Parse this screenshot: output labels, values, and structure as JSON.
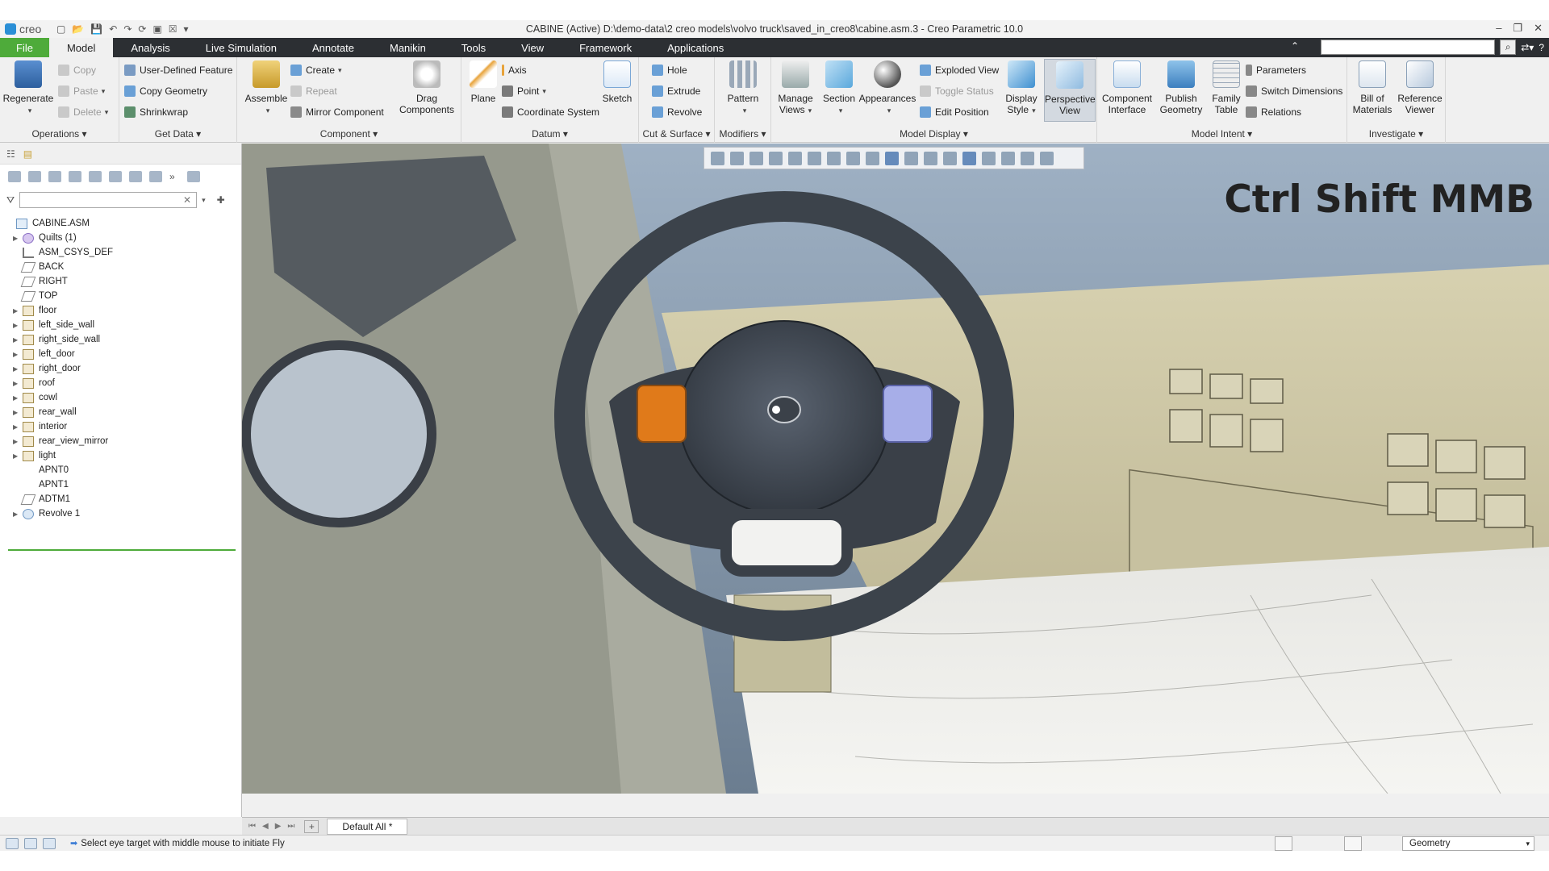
{
  "titlebar": {
    "logo": "creo",
    "title": "CABINE (Active) D:\\demo-data\\2 creo models\\volvo truck\\saved_in_creo8\\cabine.asm.3 - Creo Parametric 10.0",
    "quick_access": [
      "new-icon",
      "open-icon",
      "save-icon",
      "undo-icon",
      "redo-icon",
      "regenerate-icon",
      "windows-icon",
      "close-icon",
      "customize-icon"
    ],
    "window_controls": [
      "–",
      "❐",
      "✕"
    ]
  },
  "tabs": [
    {
      "id": "file",
      "label": "File"
    },
    {
      "id": "model",
      "label": "Model",
      "active": true
    },
    {
      "id": "analysis",
      "label": "Analysis"
    },
    {
      "id": "live-simulation",
      "label": "Live Simulation"
    },
    {
      "id": "annotate",
      "label": "Annotate"
    },
    {
      "id": "manikin",
      "label": "Manikin"
    },
    {
      "id": "tools",
      "label": "Tools"
    },
    {
      "id": "view",
      "label": "View"
    },
    {
      "id": "framework",
      "label": "Framework"
    },
    {
      "id": "applications",
      "label": "Applications"
    }
  ],
  "search": {
    "placeholder": ""
  },
  "ribbon": {
    "operations": {
      "title": "Operations",
      "regenerate": "Regenerate",
      "copy": "Copy",
      "paste": "Paste",
      "delete": "Delete"
    },
    "get_data": {
      "title": "Get Data",
      "user_defined_feature": "User-Defined Feature",
      "copy_geometry": "Copy Geometry",
      "shrinkwrap": "Shrinkwrap"
    },
    "component": {
      "title": "Component",
      "assemble": "Assemble",
      "create": "Create",
      "repeat": "Repeat",
      "mirror_component": "Mirror Component",
      "drag_components_1": "Drag",
      "drag_components_2": "Components"
    },
    "datum": {
      "title": "Datum",
      "plane": "Plane",
      "axis": "Axis",
      "point": "Point",
      "coordinate_system": "Coordinate System",
      "sketch": "Sketch"
    },
    "cut_surface": {
      "title": "Cut & Surface",
      "hole": "Hole",
      "extrude": "Extrude",
      "revolve": "Revolve"
    },
    "modifiers": {
      "title": "Modifiers",
      "pattern": "Pattern"
    },
    "model_display": {
      "title": "Model Display",
      "manage_views_1": "Manage",
      "manage_views_2": "Views",
      "section": "Section",
      "appearances": "Appearances",
      "exploded_view": "Exploded View",
      "toggle_status": "Toggle Status",
      "edit_position": "Edit Position",
      "display_style_1": "Display",
      "display_style_2": "Style",
      "perspective_view_1": "Perspective",
      "perspective_view_2": "View"
    },
    "model_intent": {
      "title": "Model Intent",
      "component_interface_1": "Component",
      "component_interface_2": "Interface",
      "publish_geometry_1": "Publish",
      "publish_geometry_2": "Geometry",
      "family_table_1": "Family",
      "family_table_2": "Table",
      "parameters": "Parameters",
      "switch_dimensions": "Switch Dimensions",
      "relations": "Relations"
    },
    "investigate": {
      "title": "Investigate",
      "bill_of_materials_1": "Bill of",
      "bill_of_materials_2": "Materials",
      "reference_viewer_1": "Reference",
      "reference_viewer_2": "Viewer"
    }
  },
  "model_tree": {
    "items": [
      {
        "label": "CABINE.ASM",
        "icon": "assembly-icon",
        "level": 0,
        "expandable": false
      },
      {
        "label": "Quilts (1)",
        "icon": "quilt-icon",
        "level": 1,
        "expandable": true
      },
      {
        "label": "ASM_CSYS_DEF",
        "icon": "csys-icon",
        "level": 1,
        "expandable": false
      },
      {
        "label": "BACK",
        "icon": "datum-plane-icon",
        "level": 1,
        "expandable": false
      },
      {
        "label": "RIGHT",
        "icon": "datum-plane-icon",
        "level": 1,
        "expandable": false
      },
      {
        "label": "TOP",
        "icon": "datum-plane-icon",
        "level": 1,
        "expandable": false
      },
      {
        "label": "floor",
        "icon": "subassembly-icon",
        "level": 1,
        "expandable": true
      },
      {
        "label": "left_side_wall",
        "icon": "subassembly-icon",
        "level": 1,
        "expandable": true
      },
      {
        "label": "right_side_wall",
        "icon": "subassembly-icon",
        "level": 1,
        "expandable": true
      },
      {
        "label": "left_door",
        "icon": "subassembly-icon",
        "level": 1,
        "expandable": true
      },
      {
        "label": "right_door",
        "icon": "subassembly-icon",
        "level": 1,
        "expandable": true
      },
      {
        "label": "roof",
        "icon": "subassembly-icon",
        "level": 1,
        "expandable": true
      },
      {
        "label": "cowl",
        "icon": "subassembly-icon",
        "level": 1,
        "expandable": true
      },
      {
        "label": "rear_wall",
        "icon": "subassembly-icon",
        "level": 1,
        "expandable": true
      },
      {
        "label": "interior",
        "icon": "subassembly-icon",
        "level": 1,
        "expandable": true
      },
      {
        "label": "rear_view_mirror",
        "icon": "subassembly-icon",
        "level": 1,
        "expandable": true
      },
      {
        "label": "light",
        "icon": "subassembly-icon",
        "level": 1,
        "expandable": true
      },
      {
        "label": "APNT0",
        "icon": "datum-point-icon",
        "level": 1,
        "expandable": false
      },
      {
        "label": "APNT1",
        "icon": "datum-point-icon",
        "level": 1,
        "expandable": false
      },
      {
        "label": "ADTM1",
        "icon": "datum-plane-icon",
        "level": 1,
        "expandable": false
      },
      {
        "label": "Revolve 1",
        "icon": "revolve-icon",
        "level": 1,
        "expandable": true
      }
    ]
  },
  "viewport": {
    "hint": "Ctrl Shift MMB",
    "graphics_toolbar": [
      "refit-icon",
      "zoom-in-icon",
      "zoom-out-icon",
      "repaint-icon",
      "display-style-icon",
      "saved-orientations-icon",
      "view-manager-icon",
      "perspective-icon",
      "spin-center-icon",
      "datum-display-icon",
      "annotation-display-icon",
      "sketch-display-icon",
      "section-icon",
      "explode-icon",
      "appearance-icon",
      "pause-icon",
      "close-icon"
    ]
  },
  "window_tabs": {
    "active": "Default All *"
  },
  "statusbar": {
    "message": "Select eye target with middle mouse to initiate Fly",
    "filter": "Geometry"
  },
  "colors": {
    "file_tab": "#4eab3a",
    "tab_bar": "#2c2f33",
    "accent_blue": "#2b8fd6"
  }
}
